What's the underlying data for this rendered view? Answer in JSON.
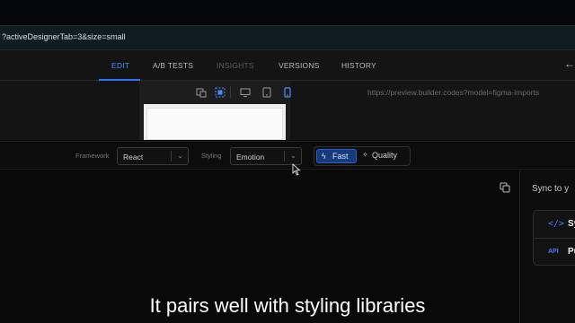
{
  "browser": {
    "url": "?activeDesignerTab=3&size=small"
  },
  "tabs": [
    {
      "label": "EDIT",
      "state": "active"
    },
    {
      "label": "A/B TESTS",
      "state": "normal"
    },
    {
      "label": "INSIGHTS",
      "state": "disabled"
    },
    {
      "label": "VERSIONS",
      "state": "normal"
    },
    {
      "label": "HISTORY",
      "state": "normal"
    }
  ],
  "header": {
    "back_icon": "arrow-left-icon"
  },
  "preview": {
    "url": "https://preview.builder.codes?model=figma-imports",
    "device_icons": [
      "responsive-icon",
      "fit-screen-icon",
      "desktop-icon",
      "tablet-icon",
      "mobile-icon"
    ],
    "selected_device": "mobile-icon"
  },
  "options": {
    "framework_label": "Framework",
    "framework_value": "React",
    "styling_label": "Styling",
    "styling_value": "Emotion",
    "mode": {
      "fast_label": "Fast",
      "quality_label": "Quality",
      "selected": "Fast"
    }
  },
  "right_panel": {
    "title": "Sync to y",
    "items": [
      {
        "icon": "code-icon",
        "label": "Sy"
      },
      {
        "icon": "api-icon",
        "icon_text": "API",
        "label": "Pu"
      }
    ]
  },
  "caption": "It pairs well with styling libraries",
  "colors": {
    "accent": "#2f74ff",
    "fast_bg": "#173a7a",
    "background": "#0a0a0a"
  }
}
